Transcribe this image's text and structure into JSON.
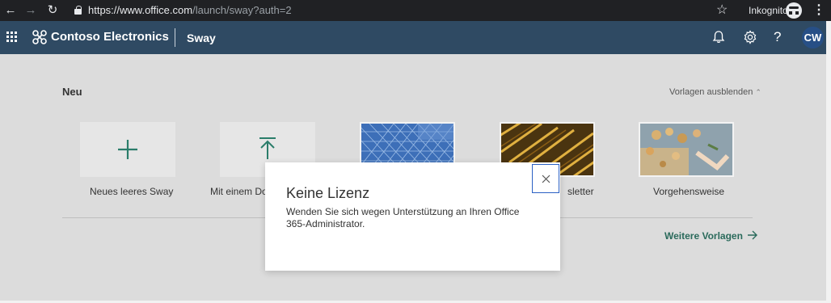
{
  "browser": {
    "url_host": "https://www.office.com",
    "url_path": "/launch/sway?auth=2",
    "incognito_label": "Inkognito",
    "back_icon": "arrow-left-icon",
    "forward_icon": "arrow-right-icon",
    "reload_icon": "reload-icon",
    "star_icon": "star-icon",
    "menu_icon": "kebab-menu-icon"
  },
  "header": {
    "brand": "Contoso Electronics",
    "app": "Sway",
    "avatar_initials": "CW",
    "colors": {
      "bar": "#2f4a63",
      "avatar": "#274f86"
    }
  },
  "main": {
    "section_title": "Neu",
    "hide_templates": "Vorlagen ausblenden",
    "tiles": [
      {
        "label": "Neues leeres Sway",
        "icon": "plus-icon"
      },
      {
        "label": "Mit einem Do",
        "icon": "upload-icon"
      },
      {
        "label": "",
        "icon": ""
      },
      {
        "label": "sletter",
        "icon": ""
      },
      {
        "label": "Vorgehensweise",
        "icon": ""
      }
    ],
    "more_templates": "Weitere Vorlagen",
    "accent": "#2a6a5b"
  },
  "modal": {
    "title": "Keine Lizenz",
    "text": "Wenden Sie sich wegen Unterstützung an Ihren Office 365-Administrator.",
    "close_icon": "close-icon"
  }
}
